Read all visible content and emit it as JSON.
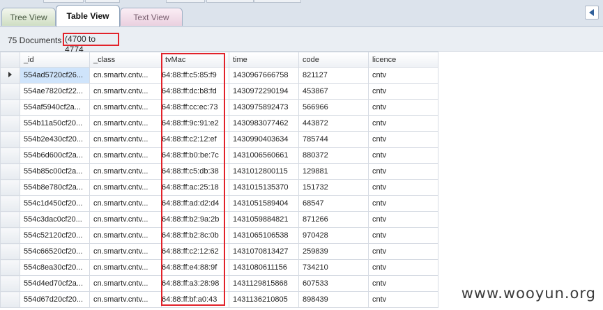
{
  "tabs": [
    {
      "label": "Tree View"
    },
    {
      "label": "Table View"
    },
    {
      "label": "Text View"
    }
  ],
  "info": {
    "document_count": "75 Documents",
    "range": "(4700 to 4774"
  },
  "grid": {
    "columns": [
      "_id",
      "_class",
      "tvMac",
      "time",
      "code",
      "licence"
    ],
    "rows": [
      [
        "554ad5720cf26...",
        "cn.smartv.cntv...",
        "64:88:ff:c5:85:f9",
        "1430967666758",
        "821127",
        "cntv"
      ],
      [
        "554ae7820cf22...",
        "cn.smartv.cntv...",
        "64:88:ff:dc:b8:fd",
        "1430972290194",
        "453867",
        "cntv"
      ],
      [
        "554af5940cf2a...",
        "cn.smartv.cntv...",
        "64:88:ff:cc:ec:73",
        "1430975892473",
        "566966",
        "cntv"
      ],
      [
        "554b11a50cf20...",
        "cn.smartv.cntv...",
        "64:88:ff:9c:91:e2",
        "1430983077462",
        "443872",
        "cntv"
      ],
      [
        "554b2e430cf20...",
        "cn.smartv.cntv...",
        "64:88:ff:c2:12:ef",
        "1430990403634",
        "785744",
        "cntv"
      ],
      [
        "554b6d600cf2a...",
        "cn.smartv.cntv...",
        "64:88:ff:b0:be:7c",
        "1431006560661",
        "880372",
        "cntv"
      ],
      [
        "554b85c00cf2a...",
        "cn.smartv.cntv...",
        "64:88:ff:c5:db:38",
        "1431012800115",
        "129881",
        "cntv"
      ],
      [
        "554b8e780cf2a...",
        "cn.smartv.cntv...",
        "64:88:ff:ac:25:18",
        "1431015135370",
        "151732",
        "cntv"
      ],
      [
        "554c1d450cf20...",
        "cn.smartv.cntv...",
        "64:88:ff:ad:d2:d4",
        "1431051589404",
        "68547",
        "cntv"
      ],
      [
        "554c3dac0cf20...",
        "cn.smartv.cntv...",
        "64:88:ff:b2:9a:2b",
        "1431059884821",
        "871266",
        "cntv"
      ],
      [
        "554c52120cf20...",
        "cn.smartv.cntv...",
        "64:88:ff:b2:8c:0b",
        "1431065106538",
        "970428",
        "cntv"
      ],
      [
        "554c66520cf20...",
        "cn.smartv.cntv...",
        "64:88:ff:c2:12:62",
        "1431070813427",
        "259839",
        "cntv"
      ],
      [
        "554c8ea30cf20...",
        "cn.smartv.cntv...",
        "64:88:ff:e4:88:9f",
        "1431080611156",
        "734210",
        "cntv"
      ],
      [
        "554d4ed70cf2a...",
        "cn.smartv.cntv...",
        "64:88:ff:a3:28:98",
        "1431129815868",
        "607533",
        "cntv"
      ],
      [
        "554d67d20cf20...",
        "cn.smartv.cntv...",
        "64:88:ff:bf:a0:43",
        "1431136210805",
        "898439",
        "cntv"
      ]
    ]
  },
  "watermark": "www.wooyun.org",
  "icons": {
    "nav": "triangle-left-icon"
  },
  "colors": {
    "highlight": "#e2222a",
    "selected_cell": "#cfe4fb"
  }
}
